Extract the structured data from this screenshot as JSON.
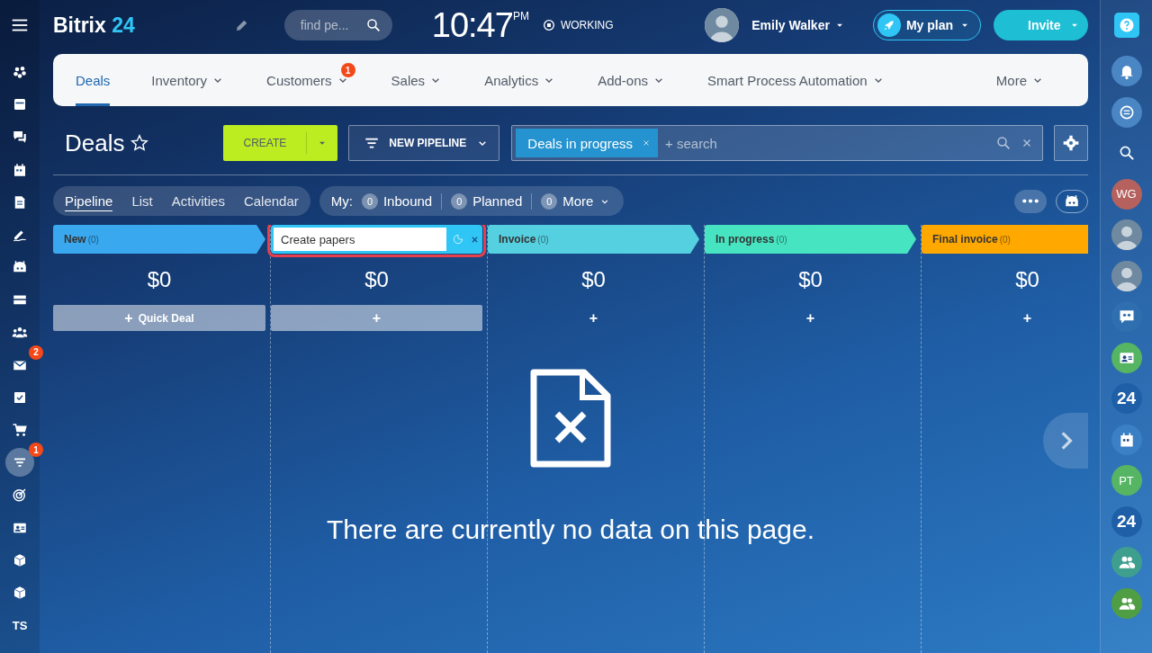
{
  "top_bar": {
    "logo": {
      "name": "Bitrix",
      "suffix": "24"
    },
    "search": {
      "placeholder": "find pe..."
    },
    "clock": {
      "time": "10:47",
      "period": "PM"
    },
    "status": "WORKING",
    "user": {
      "name": "Emily Walker"
    },
    "plan_button": "My plan",
    "invite_button": "Invite"
  },
  "left_sidebar": {
    "items": [
      {
        "kind": "icon",
        "selected": false
      },
      {
        "kind": "icon",
        "selected": false
      },
      {
        "kind": "icon",
        "selected": false
      },
      {
        "kind": "icon",
        "selected": false
      },
      {
        "kind": "icon",
        "selected": false
      },
      {
        "kind": "icon",
        "selected": false
      },
      {
        "kind": "icon",
        "selected": false
      },
      {
        "kind": "icon",
        "selected": false
      },
      {
        "kind": "icon",
        "selected": false
      },
      {
        "kind": "icon",
        "badge": "2",
        "selected": false
      },
      {
        "kind": "icon",
        "selected": false
      },
      {
        "kind": "icon",
        "selected": false
      },
      {
        "kind": "icon",
        "badge": "1",
        "selected": true
      },
      {
        "kind": "icon",
        "selected": false
      },
      {
        "kind": "icon",
        "selected": false
      },
      {
        "kind": "icon",
        "selected": false
      },
      {
        "kind": "icon",
        "selected": false
      },
      {
        "kind": "text",
        "label": "TS",
        "selected": false
      }
    ]
  },
  "right_sidebar": {
    "items": [
      {
        "kind": "icon",
        "color": "#4a85c4"
      },
      {
        "kind": "icon",
        "color": "#4a85c4"
      },
      {
        "kind": "icon"
      },
      {
        "kind": "initials",
        "label": "WG",
        "color": "#b5615e"
      },
      {
        "kind": "photo"
      },
      {
        "kind": "photo"
      },
      {
        "kind": "icon",
        "color": "#2f6fb0"
      },
      {
        "kind": "icon",
        "color": "#55b562"
      },
      {
        "kind": "initials",
        "label": "24",
        "color": "#1f5fa8"
      },
      {
        "kind": "icon",
        "color": "#3b7fc4"
      },
      {
        "kind": "initials",
        "label": "PT",
        "color": "#55b562"
      },
      {
        "kind": "initials",
        "label": "24",
        "color": "#1f5fa8"
      },
      {
        "kind": "icon",
        "color": "#3e9f8f"
      },
      {
        "kind": "icon",
        "color": "#4f9e44"
      }
    ]
  },
  "nav": {
    "tabs": [
      {
        "label": "Deals",
        "selected": true,
        "dropdown": false
      },
      {
        "label": "Inventory",
        "selected": false,
        "dropdown": true
      },
      {
        "label": "Customers",
        "selected": false,
        "dropdown": true,
        "badge": "1"
      },
      {
        "label": "Sales",
        "selected": false,
        "dropdown": true
      },
      {
        "label": "Analytics",
        "selected": false,
        "dropdown": true
      },
      {
        "label": "Add-ons",
        "selected": false,
        "dropdown": true
      },
      {
        "label": "Smart Process Automation",
        "selected": false,
        "dropdown": true
      },
      {
        "label": "More",
        "selected": false,
        "dropdown": true
      }
    ]
  },
  "toolbar": {
    "title": "Deals",
    "create_button": "CREATE",
    "pipeline_button": "NEW PIPELINE",
    "filter": {
      "tag": "Deals in progress",
      "placeholder": "+ search"
    }
  },
  "views": {
    "tabs": [
      {
        "label": "Pipeline",
        "selected": true
      },
      {
        "label": "List",
        "selected": false
      },
      {
        "label": "Activities",
        "selected": false
      },
      {
        "label": "Calendar",
        "selected": false
      }
    ],
    "my_label": "My:",
    "counters": [
      {
        "count": "0",
        "label": "Inbound",
        "dropdown": false
      },
      {
        "count": "0",
        "label": "Planned",
        "dropdown": false
      },
      {
        "count": "0",
        "label": "More",
        "dropdown": true
      }
    ]
  },
  "kanban": {
    "columns": [
      {
        "kind": "stage",
        "title": "New",
        "count": "(0)",
        "color": "#39a8ef",
        "sum": "$0",
        "add_button": {
          "symbol": "+",
          "label": "Quick Deal",
          "filled": true
        },
        "highlighted": false
      },
      {
        "kind": "editing",
        "value": "Create papers",
        "color": "#2fc6f6",
        "sum": "$0",
        "add_button": {
          "symbol": "+",
          "filled": true
        },
        "highlighted": true
      },
      {
        "kind": "stage",
        "title": "Invoice",
        "count": "(0)",
        "color": "#55d0e0",
        "sum": "$0",
        "add_button": {
          "symbol": "+",
          "filled": false
        },
        "highlighted": false
      },
      {
        "kind": "stage",
        "title": "In progress",
        "count": "(0)",
        "color": "#47e4c2",
        "sum": "$0",
        "add_button": {
          "symbol": "+",
          "filled": false
        },
        "highlighted": false
      },
      {
        "kind": "stage",
        "title": "Final invoice",
        "count": "(0)",
        "color": "#ffa900",
        "sum": "$0",
        "add_button": {
          "symbol": "+",
          "filled": false
        },
        "highlighted": false
      }
    ],
    "empty_message": "There are currently no data on this page."
  }
}
